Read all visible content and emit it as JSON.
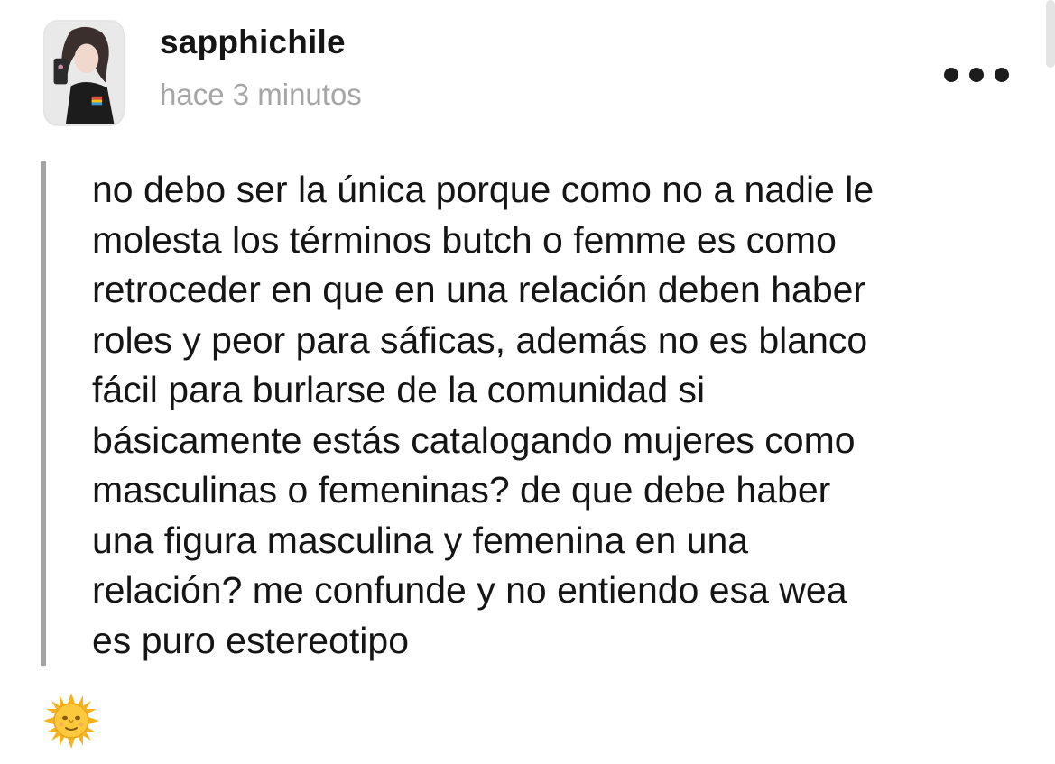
{
  "post": {
    "username": "sapphichile",
    "timestamp": "hace 3 minutos",
    "more_icon": "more-horizontal-icon",
    "body_lines": [
      "no debo ser la única porque como no a nadie le",
      "molesta los términos butch o femme es como",
      "retroceder en que en una relación deben haber",
      "roles y peor para sáficas, además no es blanco",
      "fácil para burlarse de la comunidad si",
      "básicamente estás catalogando mujeres como",
      "masculinas o femeninas? de que debe haber",
      "una figura masculina y femenina en una",
      "relación? me confunde y no entiendo esa wea",
      "es puro estereotipo"
    ],
    "reaction_icon": "sun-with-face-icon"
  },
  "colors": {
    "username": "#151515",
    "timestamp": "#a6a6a6",
    "quote_bar": "#a3a3a3",
    "background": "#ffffff"
  }
}
